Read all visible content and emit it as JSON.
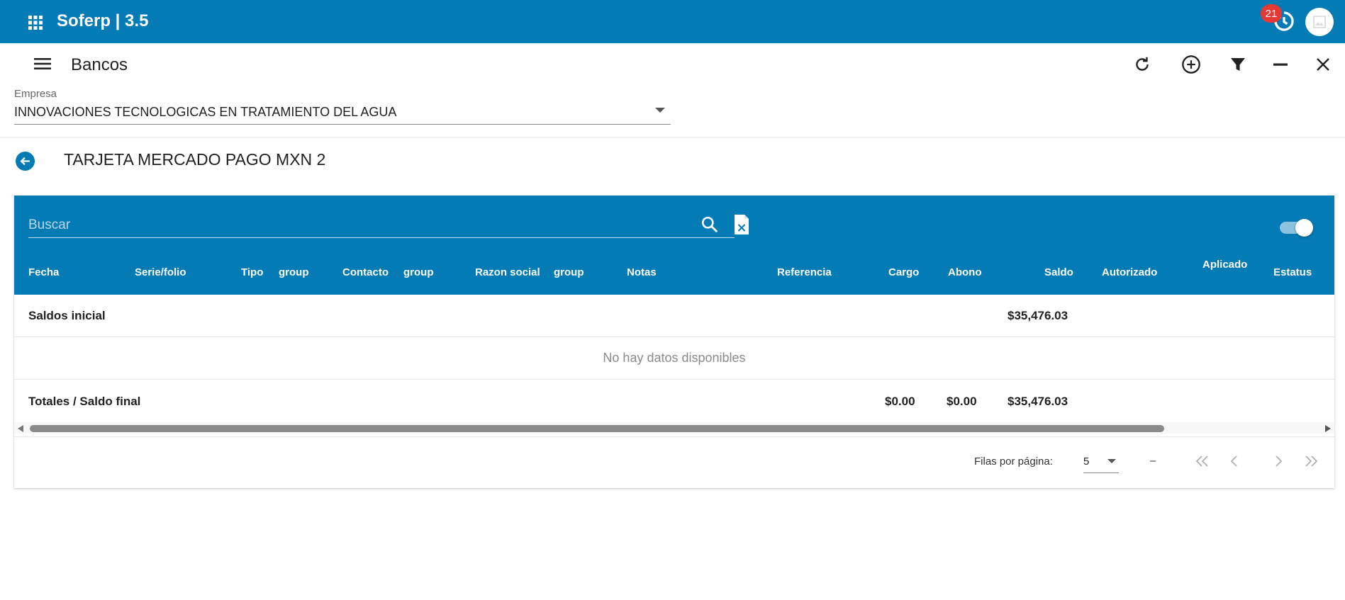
{
  "app": {
    "title": "Soferp | 3.5",
    "notifications_count": "21"
  },
  "toolbar": {
    "title": "Bancos"
  },
  "empresa": {
    "label": "Empresa",
    "value": "INNOVACIONES TECNOLOGICAS EN TRATAMIENTO DEL AGUA"
  },
  "account": {
    "title": "TARJETA MERCADO PAGO MXN 2"
  },
  "search": {
    "placeholder": "Buscar"
  },
  "columns": [
    "Fecha",
    "Serie/folio",
    "Tipo",
    "group",
    "Contacto",
    "group",
    "Razon social",
    "group",
    "Notas",
    "Referencia",
    "Cargo",
    "Abono",
    "Saldo",
    "Autorizado",
    "Aplicado",
    "Estatus"
  ],
  "rows": {
    "initial": {
      "label": "Saldos inicial",
      "saldo": "$35,476.03"
    },
    "empty": "No hay datos disponibles",
    "totals": {
      "label": "Totales / Saldo final",
      "cargo": "$0.00",
      "abono": "$0.00",
      "saldo": "$35,476.03"
    }
  },
  "pagination": {
    "rows_per_page_label": "Filas por página:",
    "rows_per_page": "5",
    "range": "–"
  },
  "colors": {
    "primary": "#047bb4",
    "badge": "#e53935"
  }
}
